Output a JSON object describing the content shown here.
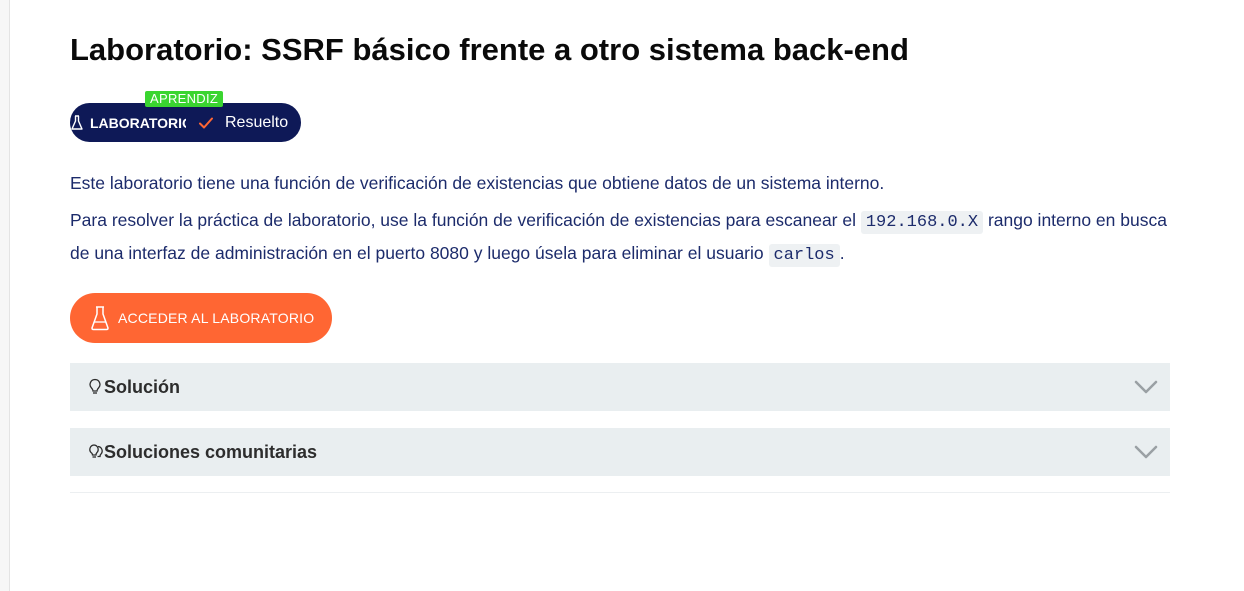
{
  "lab": {
    "title": "Laboratorio: SSRF básico frente a otro sistema back-end",
    "learn_tag": "APRENDIZ",
    "type_label": "LABORATORIO",
    "status_label": "Resuelto"
  },
  "description": {
    "paragraph1": "Este laboratorio tiene una función de verificación de existencias que obtiene datos de un sistema interno.",
    "p2_part1": "Para resolver la práctica de laboratorio, use la función de verificación de existencias para escanear el ",
    "p2_code1": "192.168.0.X",
    "p2_part2": " rango interno en busca de una interfaz de administración en el puerto 8080 y luego úsela para eliminar el usuario ",
    "p2_code2": "carlos",
    "p2_part3": "."
  },
  "actions": {
    "access_label": "ACCEDER AL LABORATORIO"
  },
  "accordions": {
    "solution_label": "Solución",
    "community_label": "Soluciones comunitarias"
  },
  "icons": {
    "flask": "flask-icon",
    "check": "check-icon",
    "lightbulb": "lightbulb-icon",
    "community": "community-lightbulbs-icon",
    "chevron": "chevron-down-icon"
  },
  "colors": {
    "accent": "#ff6633",
    "navy": "#0e1957",
    "learn_green": "#3ad530",
    "text": "#1c2b6b"
  }
}
